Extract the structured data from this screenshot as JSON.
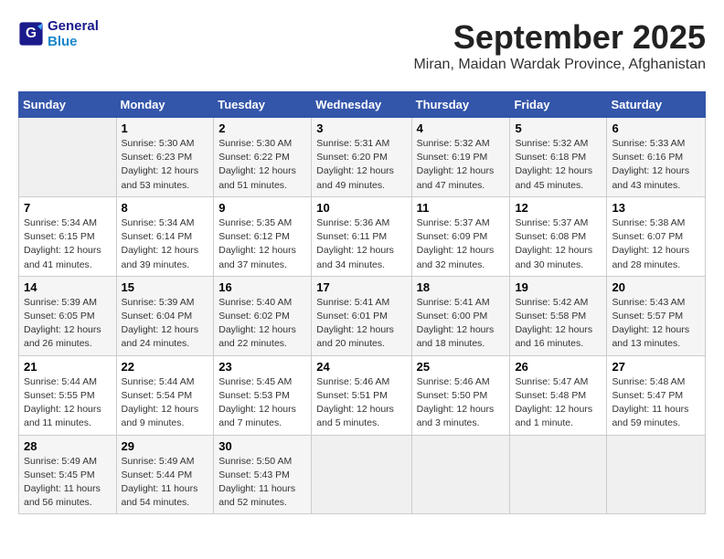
{
  "logo": {
    "line1": "General",
    "line2": "Blue"
  },
  "title": "September 2025",
  "location": "Miran, Maidan Wardak Province, Afghanistan",
  "days_of_week": [
    "Sunday",
    "Monday",
    "Tuesday",
    "Wednesday",
    "Thursday",
    "Friday",
    "Saturday"
  ],
  "weeks": [
    [
      {
        "day": "",
        "empty": true
      },
      {
        "day": "1",
        "sunrise": "5:30 AM",
        "sunset": "6:23 PM",
        "daylight": "12 hours and 53 minutes."
      },
      {
        "day": "2",
        "sunrise": "5:30 AM",
        "sunset": "6:22 PM",
        "daylight": "12 hours and 51 minutes."
      },
      {
        "day": "3",
        "sunrise": "5:31 AM",
        "sunset": "6:20 PM",
        "daylight": "12 hours and 49 minutes."
      },
      {
        "day": "4",
        "sunrise": "5:32 AM",
        "sunset": "6:19 PM",
        "daylight": "12 hours and 47 minutes."
      },
      {
        "day": "5",
        "sunrise": "5:32 AM",
        "sunset": "6:18 PM",
        "daylight": "12 hours and 45 minutes."
      },
      {
        "day": "6",
        "sunrise": "5:33 AM",
        "sunset": "6:16 PM",
        "daylight": "12 hours and 43 minutes."
      }
    ],
    [
      {
        "day": "7",
        "sunrise": "5:34 AM",
        "sunset": "6:15 PM",
        "daylight": "12 hours and 41 minutes."
      },
      {
        "day": "8",
        "sunrise": "5:34 AM",
        "sunset": "6:14 PM",
        "daylight": "12 hours and 39 minutes."
      },
      {
        "day": "9",
        "sunrise": "5:35 AM",
        "sunset": "6:12 PM",
        "daylight": "12 hours and 37 minutes."
      },
      {
        "day": "10",
        "sunrise": "5:36 AM",
        "sunset": "6:11 PM",
        "daylight": "12 hours and 34 minutes."
      },
      {
        "day": "11",
        "sunrise": "5:37 AM",
        "sunset": "6:09 PM",
        "daylight": "12 hours and 32 minutes."
      },
      {
        "day": "12",
        "sunrise": "5:37 AM",
        "sunset": "6:08 PM",
        "daylight": "12 hours and 30 minutes."
      },
      {
        "day": "13",
        "sunrise": "5:38 AM",
        "sunset": "6:07 PM",
        "daylight": "12 hours and 28 minutes."
      }
    ],
    [
      {
        "day": "14",
        "sunrise": "5:39 AM",
        "sunset": "6:05 PM",
        "daylight": "12 hours and 26 minutes."
      },
      {
        "day": "15",
        "sunrise": "5:39 AM",
        "sunset": "6:04 PM",
        "daylight": "12 hours and 24 minutes."
      },
      {
        "day": "16",
        "sunrise": "5:40 AM",
        "sunset": "6:02 PM",
        "daylight": "12 hours and 22 minutes."
      },
      {
        "day": "17",
        "sunrise": "5:41 AM",
        "sunset": "6:01 PM",
        "daylight": "12 hours and 20 minutes."
      },
      {
        "day": "18",
        "sunrise": "5:41 AM",
        "sunset": "6:00 PM",
        "daylight": "12 hours and 18 minutes."
      },
      {
        "day": "19",
        "sunrise": "5:42 AM",
        "sunset": "5:58 PM",
        "daylight": "12 hours and 16 minutes."
      },
      {
        "day": "20",
        "sunrise": "5:43 AM",
        "sunset": "5:57 PM",
        "daylight": "12 hours and 13 minutes."
      }
    ],
    [
      {
        "day": "21",
        "sunrise": "5:44 AM",
        "sunset": "5:55 PM",
        "daylight": "12 hours and 11 minutes."
      },
      {
        "day": "22",
        "sunrise": "5:44 AM",
        "sunset": "5:54 PM",
        "daylight": "12 hours and 9 minutes."
      },
      {
        "day": "23",
        "sunrise": "5:45 AM",
        "sunset": "5:53 PM",
        "daylight": "12 hours and 7 minutes."
      },
      {
        "day": "24",
        "sunrise": "5:46 AM",
        "sunset": "5:51 PM",
        "daylight": "12 hours and 5 minutes."
      },
      {
        "day": "25",
        "sunrise": "5:46 AM",
        "sunset": "5:50 PM",
        "daylight": "12 hours and 3 minutes."
      },
      {
        "day": "26",
        "sunrise": "5:47 AM",
        "sunset": "5:48 PM",
        "daylight": "12 hours and 1 minute."
      },
      {
        "day": "27",
        "sunrise": "5:48 AM",
        "sunset": "5:47 PM",
        "daylight": "11 hours and 59 minutes."
      }
    ],
    [
      {
        "day": "28",
        "sunrise": "5:49 AM",
        "sunset": "5:45 PM",
        "daylight": "11 hours and 56 minutes."
      },
      {
        "day": "29",
        "sunrise": "5:49 AM",
        "sunset": "5:44 PM",
        "daylight": "11 hours and 54 minutes."
      },
      {
        "day": "30",
        "sunrise": "5:50 AM",
        "sunset": "5:43 PM",
        "daylight": "11 hours and 52 minutes."
      },
      {
        "day": "",
        "empty": true
      },
      {
        "day": "",
        "empty": true
      },
      {
        "day": "",
        "empty": true
      },
      {
        "day": "",
        "empty": true
      }
    ]
  ]
}
